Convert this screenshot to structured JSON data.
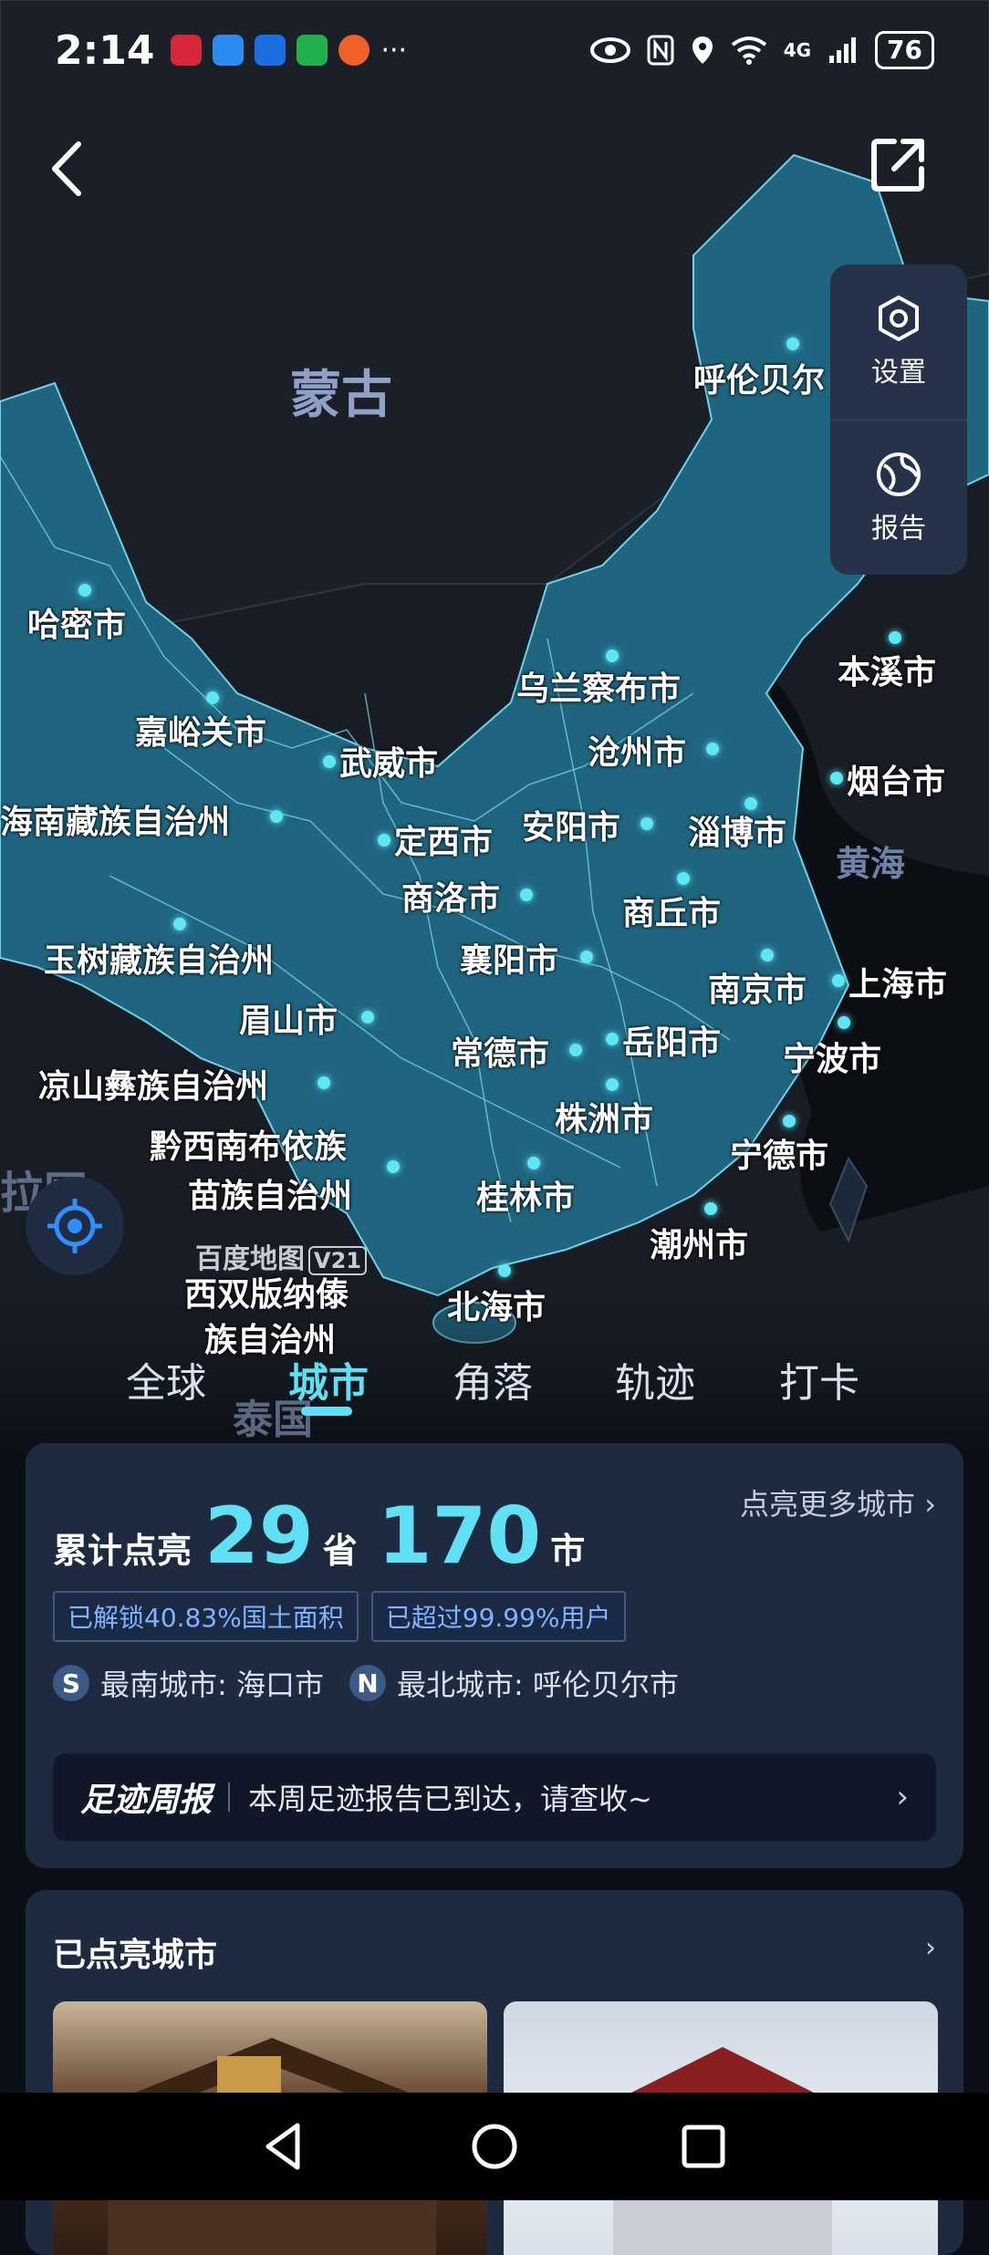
{
  "status_bar": {
    "time": "2:14",
    "more": "···",
    "network": "4G",
    "battery": "76"
  },
  "map": {
    "country_labels": [
      "蒙古",
      "泰国",
      "拉国"
    ],
    "sea_labels": [
      "黄海"
    ],
    "cities": [
      "呼伦贝尔",
      "哈密市",
      "嘉峪关市",
      "武威市",
      "乌兰察布市",
      "本溪市",
      "沧州市",
      "烟台市",
      "海南藏族自治州",
      "定西市",
      "安阳市",
      "淄博市",
      "商洛市",
      "商丘市",
      "玉树藏族自治州",
      "襄阳市",
      "南京市",
      "上海市",
      "眉山市",
      "常德市",
      "岳阳市",
      "宁波市",
      "凉山彝族自治州",
      "株洲市",
      "黔西南布依族",
      "苗族自治州",
      "宁德市",
      "桂林市",
      "潮州市",
      "西双版纳傣",
      "族自治州",
      "北海市"
    ],
    "logo_text": "百度地图",
    "logo_version": "V21"
  },
  "side_panel": {
    "settings_label": "设置",
    "report_label": "报告"
  },
  "tabs": [
    {
      "label": "全球",
      "active": false
    },
    {
      "label": "城市",
      "active": true
    },
    {
      "label": "角落",
      "active": false
    },
    {
      "label": "轨迹",
      "active": false
    },
    {
      "label": "打卡",
      "active": false
    }
  ],
  "stats": {
    "prefix": "累计点亮",
    "provinces": "29",
    "province_unit": "省",
    "cities": "170",
    "city_unit": "市",
    "more_link": "点亮更多城市",
    "badge_area": "已解锁40.83%国土面积",
    "badge_users": "已超过99.99%用户",
    "south_letter": "S",
    "south_text": "最南城市: 海口市",
    "north_letter": "N",
    "north_text": "最北城市: 呼伦贝尔市",
    "weekly_title": "足迹周报",
    "weekly_text": "本周足迹报告已到达，请查收~"
  },
  "lit_cities": {
    "title": "已点亮城市"
  },
  "colors": {
    "accent": "#5fe0f5",
    "card_bg": "#1e2a3f",
    "map_region": "#1e5f78"
  }
}
